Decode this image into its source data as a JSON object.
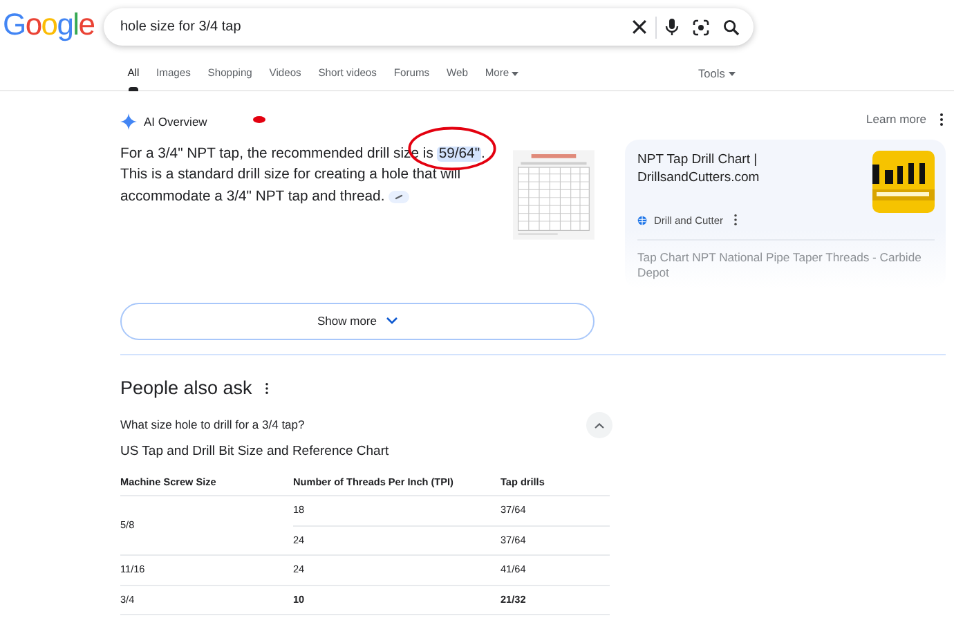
{
  "logo": "Google",
  "search": {
    "query": "hole size for 3/4 tap"
  },
  "tabs": [
    {
      "label": "All",
      "selected": true,
      "dropdown": false
    },
    {
      "label": "Images",
      "selected": false,
      "dropdown": false
    },
    {
      "label": "Shopping",
      "selected": false,
      "dropdown": false
    },
    {
      "label": "Videos",
      "selected": false,
      "dropdown": false
    },
    {
      "label": "Short videos",
      "selected": false,
      "dropdown": false
    },
    {
      "label": "Forums",
      "selected": false,
      "dropdown": false
    },
    {
      "label": "Web",
      "selected": false,
      "dropdown": false
    },
    {
      "label": "More",
      "selected": false,
      "dropdown": true
    }
  ],
  "tools": {
    "label": "Tools"
  },
  "ai_overview": {
    "title": "AI Overview",
    "learn_more": "Learn more",
    "segments": [
      {
        "text": "For a 3/4\" NPT tap, the recommended drill size is ",
        "highlighted": false
      },
      {
        "text": "59/64\"",
        "highlighted": true
      },
      {
        "text": ". This is a standard drill size for creating a hole that will accommodate a 3/4\" NPT tap and thread.",
        "highlighted": false
      }
    ],
    "show_more": "Show more",
    "source_card": {
      "title": "NPT Tap Drill Chart | DrillsandCutters.com",
      "site": "Drill and Cutter",
      "faded_text": "Tap Chart NPT National Pipe Taper Threads - Carbide Depot"
    }
  },
  "people_also_ask": {
    "title": "People also ask",
    "question": {
      "text": "What size hole to drill for a 3/4 tap?",
      "expanded": true
    },
    "answer_title": "US Tap and Drill Bit Size and Reference Chart",
    "table": {
      "columns": [
        "Machine Screw Size",
        "Number of Threads Per Inch (TPI)",
        "Tap drills"
      ],
      "groups": [
        {
          "size": "5/8",
          "bold": false,
          "rows": [
            {
              "tpi": "18",
              "drill": "37/64"
            },
            {
              "tpi": "24",
              "drill": "37/64"
            }
          ]
        },
        {
          "size": "11/16",
          "bold": false,
          "rows": [
            {
              "tpi": "24",
              "drill": "41/64"
            }
          ]
        },
        {
          "size": "3/4",
          "bold": true,
          "rows": [
            {
              "tpi": "10",
              "drill": "21/32"
            }
          ]
        }
      ]
    }
  }
}
